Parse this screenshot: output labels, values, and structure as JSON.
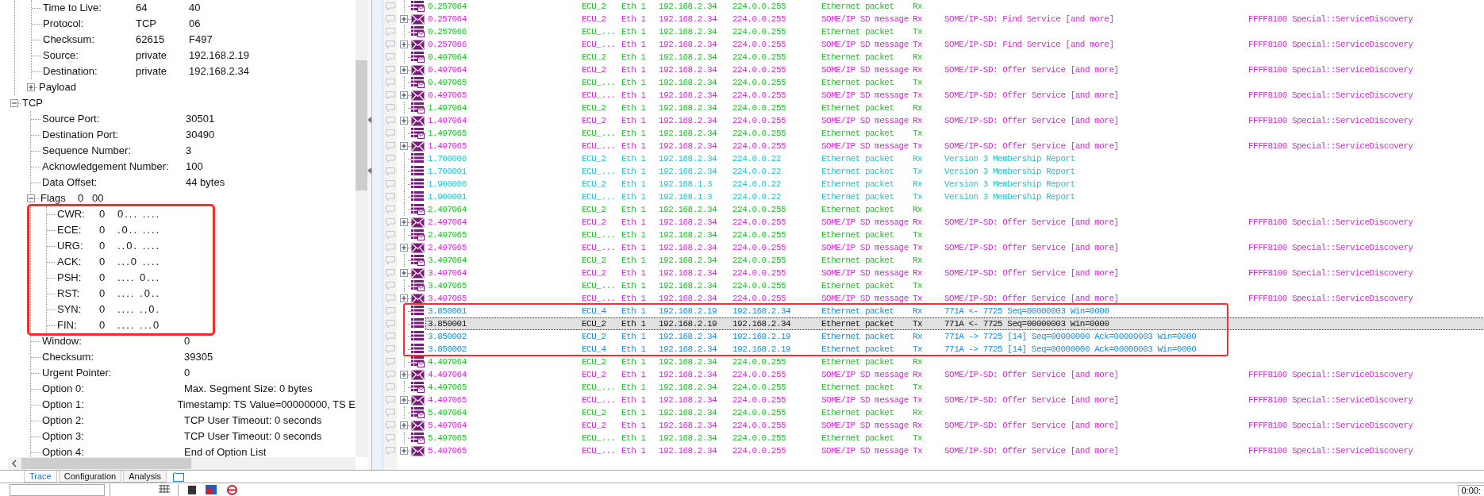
{
  "detail_tree": {
    "ip_fields": [
      {
        "label": "Time to Live:",
        "value": "64",
        "raw": "40"
      },
      {
        "label": "Protocol:",
        "value": "TCP",
        "raw": "06"
      },
      {
        "label": "Checksum:",
        "value": "62615",
        "raw": "F497"
      },
      {
        "label": "Source:",
        "value": "private",
        "raw": "192.168.2.19"
      },
      {
        "label": "Destination:",
        "value": "private",
        "raw": "192.168.2.34"
      }
    ],
    "payload": {
      "label": "Payload",
      "expanded": false
    },
    "tcp": {
      "label": "TCP",
      "expanded": true,
      "fields": [
        {
          "label": "Source Port:",
          "value": "30501"
        },
        {
          "label": "Destination Port:",
          "value": "30490"
        },
        {
          "label": "Sequence Number:",
          "value": "3"
        },
        {
          "label": "Acknowledgement Number:",
          "value": "100"
        },
        {
          "label": "Data Offset:",
          "value": "44 bytes"
        }
      ],
      "flags": {
        "label": "Flags",
        "value": "0",
        "raw": "00",
        "expanded": true,
        "outlined": true,
        "items": [
          {
            "label": "CWR:",
            "value": "0",
            "bits": "0... ...."
          },
          {
            "label": "ECE:",
            "value": "0",
            "bits": ".0.. ...."
          },
          {
            "label": "URG:",
            "value": "0",
            "bits": "..0. ...."
          },
          {
            "label": "ACK:",
            "value": "0",
            "bits": "...0 ...."
          },
          {
            "label": "PSH:",
            "value": "0",
            "bits": ".... 0..."
          },
          {
            "label": "RST:",
            "value": "0",
            "bits": ".... .0.."
          },
          {
            "label": "SYN:",
            "value": "0",
            "bits": ".... ..0."
          },
          {
            "label": "FIN:",
            "value": "0",
            "bits": ".... ...0"
          }
        ]
      },
      "fields_after": [
        {
          "label": "Window:",
          "value": "0"
        },
        {
          "label": "Checksum:",
          "value": "39305"
        },
        {
          "label": "Urgent Pointer:",
          "value": "0"
        },
        {
          "label": "Option 0:",
          "value": "Max. Segment Size: 0 bytes"
        },
        {
          "label": "Option 1:",
          "value": "Timestamp: TS Value=00000000, TS E"
        },
        {
          "label": "Option 2:",
          "value": "TCP User Timeout: 0 seconds"
        },
        {
          "label": "Option 3:",
          "value": "TCP User Timeout: 0 seconds"
        },
        {
          "label": "Option 4:",
          "value": "End of Option List"
        }
      ]
    }
  },
  "tabs": [
    {
      "label": "Trace",
      "selected": true
    },
    {
      "label": "Configuration",
      "selected": false
    },
    {
      "label": "Analysis",
      "selected": false
    }
  ],
  "trace": {
    "rows": [
      {
        "kind": "frame",
        "time": "0.257064",
        "ecu": "ECU_2",
        "channel": "Eth 1",
        "source": "192.168.2.34",
        "destination": "224.0.0.255",
        "type": "Ethernet packet",
        "dir": "Rx",
        "color": "#22c02a",
        "selected": false
      },
      {
        "kind": "someip",
        "time": "0.257064",
        "ecu": "ECU_2",
        "channel": "Eth 1",
        "source": "192.168.2.34",
        "destination": "224.0.0.255",
        "type": "SOME/IP SD message",
        "dir": "Rx",
        "info": "SOME/IP-SD: Find Service [and more]",
        "id": "FFFF8100 Special::ServiceDiscovery",
        "color": "#d42ad4",
        "expanded": false,
        "selected": false
      },
      {
        "kind": "frame",
        "time": "0.257066",
        "ecu": "ECU_...",
        "channel": "Eth 1",
        "source": "192.168.2.34",
        "destination": "224.0.0.255",
        "type": "Ethernet packet",
        "dir": "Tx",
        "color": "#22c02a",
        "selected": false
      },
      {
        "kind": "someip",
        "time": "0.257066",
        "ecu": "ECU_...",
        "channel": "Eth 1",
        "source": "192.168.2.34",
        "destination": "224.0.0.255",
        "type": "SOME/IP SD message",
        "dir": "Tx",
        "info": "SOME/IP-SD: Find Service [and more]",
        "id": "FFFF8100 Special::ServiceDiscovery",
        "color": "#d42ad4",
        "expanded": false,
        "selected": false
      },
      {
        "kind": "frame",
        "time": "0.497064",
        "ecu": "ECU_2",
        "channel": "Eth 1",
        "source": "192.168.2.34",
        "destination": "224.0.0.255",
        "type": "Ethernet packet",
        "dir": "Rx",
        "color": "#22c02a",
        "selected": false
      },
      {
        "kind": "someip",
        "time": "0.497064",
        "ecu": "ECU_2",
        "channel": "Eth 1",
        "source": "192.168.2.34",
        "destination": "224.0.0.255",
        "type": "SOME/IP SD message",
        "dir": "Rx",
        "info": "SOME/IP-SD: Offer Service [and more]",
        "id": "FFFF8100 Special::ServiceDiscovery",
        "color": "#d42ad4",
        "expanded": false,
        "selected": false
      },
      {
        "kind": "frame",
        "time": "0.497065",
        "ecu": "ECU_...",
        "channel": "Eth 1",
        "source": "192.168.2.34",
        "destination": "224.0.0.255",
        "type": "Ethernet packet",
        "dir": "Tx",
        "color": "#22c02a",
        "selected": false
      },
      {
        "kind": "someip",
        "time": "0.497065",
        "ecu": "ECU_...",
        "channel": "Eth 1",
        "source": "192.168.2.34",
        "destination": "224.0.0.255",
        "type": "SOME/IP SD message",
        "dir": "Tx",
        "info": "SOME/IP-SD: Offer Service [and more]",
        "id": "FFFF8100 Special::ServiceDiscovery",
        "color": "#d42ad4",
        "expanded": false,
        "selected": false
      },
      {
        "kind": "frame",
        "time": "1.497064",
        "ecu": "ECU_2",
        "channel": "Eth 1",
        "source": "192.168.2.34",
        "destination": "224.0.0.255",
        "type": "Ethernet packet",
        "dir": "Rx",
        "color": "#22c02a",
        "selected": false
      },
      {
        "kind": "someip",
        "time": "1.497064",
        "ecu": "ECU_2",
        "channel": "Eth 1",
        "source": "192.168.2.34",
        "destination": "224.0.0.255",
        "type": "SOME/IP SD message",
        "dir": "Rx",
        "info": "SOME/IP-SD: Offer Service [and more]",
        "id": "FFFF8100 Special::ServiceDiscovery",
        "color": "#d42ad4",
        "expanded": false,
        "selected": false
      },
      {
        "kind": "frame",
        "time": "1.497065",
        "ecu": "ECU_...",
        "channel": "Eth 1",
        "source": "192.168.2.34",
        "destination": "224.0.0.255",
        "type": "Ethernet packet",
        "dir": "Tx",
        "color": "#22c02a",
        "selected": false
      },
      {
        "kind": "someip",
        "time": "1.497065",
        "ecu": "ECU_...",
        "channel": "Eth 1",
        "source": "192.168.2.34",
        "destination": "224.0.0.255",
        "type": "SOME/IP SD message",
        "dir": "Tx",
        "info": "SOME/IP-SD: Offer Service [and more]",
        "id": "FFFF8100 Special::ServiceDiscovery",
        "color": "#d42ad4",
        "expanded": false,
        "selected": false
      },
      {
        "kind": "packet",
        "time": "1.700000",
        "ecu": "ECU_2",
        "channel": "Eth 1",
        "source": "192.168.2.34",
        "destination": "224.0.0.22",
        "type": "Ethernet packet",
        "dir": "Rx",
        "info": "Version 3 Membership Report",
        "color": "#22c4d2",
        "selected": false
      },
      {
        "kind": "packet",
        "time": "1.700001",
        "ecu": "ECU_...",
        "channel": "Eth 1",
        "source": "192.168.2.34",
        "destination": "224.0.0.22",
        "type": "Ethernet packet",
        "dir": "Tx",
        "info": "Version 3 Membership Report",
        "color": "#22c4d2",
        "selected": false
      },
      {
        "kind": "packet",
        "time": "1.900000",
        "ecu": "ECU_2",
        "channel": "Eth 1",
        "source": "192.168.1.3",
        "destination": "224.0.0.22",
        "type": "Ethernet packet",
        "dir": "Rx",
        "info": "Version 3 Membership Report",
        "color": "#22c4d2",
        "selected": false
      },
      {
        "kind": "packet",
        "time": "1.900001",
        "ecu": "ECU_...",
        "channel": "Eth 1",
        "source": "192.168.1.3",
        "destination": "224.0.0.22",
        "type": "Ethernet packet",
        "dir": "Tx",
        "info": "Version 3 Membership Report",
        "color": "#22c4d2",
        "selected": false
      },
      {
        "kind": "frame",
        "time": "2.497064",
        "ecu": "ECU_2",
        "channel": "Eth 1",
        "source": "192.168.2.34",
        "destination": "224.0.0.255",
        "type": "Ethernet packet",
        "dir": "Rx",
        "color": "#22c02a",
        "selected": false
      },
      {
        "kind": "someip",
        "time": "2.497064",
        "ecu": "ECU_2",
        "channel": "Eth 1",
        "source": "192.168.2.34",
        "destination": "224.0.0.255",
        "type": "SOME/IP SD message",
        "dir": "Rx",
        "info": "SOME/IP-SD: Offer Service [and more]",
        "id": "FFFF8100 Special::ServiceDiscovery",
        "color": "#d42ad4",
        "expanded": false,
        "selected": false
      },
      {
        "kind": "frame",
        "time": "2.497065",
        "ecu": "ECU_...",
        "channel": "Eth 1",
        "source": "192.168.2.34",
        "destination": "224.0.0.255",
        "type": "Ethernet packet",
        "dir": "Tx",
        "color": "#22c02a",
        "selected": false
      },
      {
        "kind": "someip",
        "time": "2.497065",
        "ecu": "ECU_...",
        "channel": "Eth 1",
        "source": "192.168.2.34",
        "destination": "224.0.0.255",
        "type": "SOME/IP SD message",
        "dir": "Tx",
        "info": "SOME/IP-SD: Offer Service [and more]",
        "id": "FFFF8100 Special::ServiceDiscovery",
        "color": "#d42ad4",
        "expanded": false,
        "selected": false
      },
      {
        "kind": "frame",
        "time": "3.497064",
        "ecu": "ECU_2",
        "channel": "Eth 1",
        "source": "192.168.2.34",
        "destination": "224.0.0.255",
        "type": "Ethernet packet",
        "dir": "Rx",
        "color": "#22c02a",
        "selected": false
      },
      {
        "kind": "someip",
        "time": "3.497064",
        "ecu": "ECU_2",
        "channel": "Eth 1",
        "source": "192.168.2.34",
        "destination": "224.0.0.255",
        "type": "SOME/IP SD message",
        "dir": "Rx",
        "info": "SOME/IP-SD: Offer Service [and more]",
        "id": "FFFF8100 Special::ServiceDiscovery",
        "color": "#d42ad4",
        "expanded": false,
        "selected": false
      },
      {
        "kind": "frame",
        "time": "3.497065",
        "ecu": "ECU_...",
        "channel": "Eth 1",
        "source": "192.168.2.34",
        "destination": "224.0.0.255",
        "type": "Ethernet packet",
        "dir": "Tx",
        "color": "#22c02a",
        "selected": false
      },
      {
        "kind": "someip",
        "time": "3.497065",
        "ecu": "ECU_...",
        "channel": "Eth 1",
        "source": "192.168.2.34",
        "destination": "224.0.0.255",
        "type": "SOME/IP SD message",
        "dir": "Tx",
        "info": "SOME/IP-SD: Offer Service [and more]",
        "id": "FFFF8100 Special::ServiceDiscovery",
        "color": "#d42ad4",
        "expanded": false,
        "selected": false
      },
      {
        "kind": "packet",
        "time": "3.850001",
        "ecu": "ECU_4",
        "channel": "Eth 1",
        "source": "192.168.2.19",
        "destination": "192.168.2.34",
        "type": "Ethernet packet",
        "dir": "Rx",
        "info": "771A <- 7725 Seq=00000003 Win=0000",
        "color": "#1a8ed6",
        "outlined": true,
        "selected": false
      },
      {
        "kind": "packet",
        "time": "3.850001",
        "ecu": "ECU_2",
        "channel": "Eth 1",
        "source": "192.168.2.19",
        "destination": "192.168.2.34",
        "type": "Ethernet packet",
        "dir": "Tx",
        "info": "771A <- 7725 Seq=00000003 Win=0000",
        "outlined": true,
        "selected": true
      },
      {
        "kind": "packet",
        "time": "3.850002",
        "ecu": "ECU_2",
        "channel": "Eth 1",
        "source": "192.168.2.34",
        "destination": "192.168.2.19",
        "type": "Ethernet packet",
        "dir": "Rx",
        "info": "771A -> 7725 [14] Seq=00000000 Ack=00000003 Win=0000",
        "color": "#1a8ed6",
        "outlined": true,
        "selected": false
      },
      {
        "kind": "packet",
        "time": "3.850002",
        "ecu": "ECU_4",
        "channel": "Eth 1",
        "source": "192.168.2.34",
        "destination": "192.168.2.19",
        "type": "Ethernet packet",
        "dir": "Tx",
        "info": "771A -> 7725 [14] Seq=00000000 Ack=00000003 Win=0000",
        "color": "#1a8ed6",
        "outlined": true,
        "selected": false
      },
      {
        "kind": "frame",
        "time": "4.497064",
        "ecu": "ECU_2",
        "channel": "Eth 1",
        "source": "192.168.2.34",
        "destination": "224.0.0.255",
        "type": "Ethernet packet",
        "dir": "Rx",
        "color": "#22c02a",
        "selected": false
      },
      {
        "kind": "someip",
        "time": "4.497064",
        "ecu": "ECU_2",
        "channel": "Eth 1",
        "source": "192.168.2.34",
        "destination": "224.0.0.255",
        "type": "SOME/IP SD message",
        "dir": "Rx",
        "info": "SOME/IP-SD: Offer Service [and more]",
        "id": "FFFF8100 Special::ServiceDiscovery",
        "color": "#d42ad4",
        "expanded": false,
        "selected": false
      },
      {
        "kind": "frame",
        "time": "4.497065",
        "ecu": "ECU_...",
        "channel": "Eth 1",
        "source": "192.168.2.34",
        "destination": "224.0.0.255",
        "type": "Ethernet packet",
        "dir": "Tx",
        "color": "#22c02a",
        "selected": false
      },
      {
        "kind": "someip",
        "time": "4.497065",
        "ecu": "ECU_...",
        "channel": "Eth 1",
        "source": "192.168.2.34",
        "destination": "224.0.0.255",
        "type": "SOME/IP SD message",
        "dir": "Tx",
        "info": "SOME/IP-SD: Offer Service [and more]",
        "id": "FFFF8100 Special::ServiceDiscovery",
        "color": "#d42ad4",
        "expanded": false,
        "selected": false
      },
      {
        "kind": "frame",
        "time": "5.497064",
        "ecu": "ECU_2",
        "channel": "Eth 1",
        "source": "192.168.2.34",
        "destination": "224.0.0.255",
        "type": "Ethernet packet",
        "dir": "Rx",
        "color": "#22c02a",
        "selected": false
      },
      {
        "kind": "someip",
        "time": "5.497064",
        "ecu": "ECU_2",
        "channel": "Eth 1",
        "source": "192.168.2.34",
        "destination": "224.0.0.255",
        "type": "SOME/IP SD message",
        "dir": "Rx",
        "info": "SOME/IP-SD: Offer Service [and more]",
        "id": "FFFF8100 Special::ServiceDiscovery",
        "color": "#d42ad4",
        "expanded": false,
        "selected": false
      },
      {
        "kind": "frame",
        "time": "5.497065",
        "ecu": "ECU_...",
        "channel": "Eth 1",
        "source": "192.168.2.34",
        "destination": "224.0.0.255",
        "type": "Ethernet packet",
        "dir": "Tx",
        "color": "#22c02a",
        "selected": false
      },
      {
        "kind": "someip",
        "time": "5.497065",
        "ecu": "ECU_...",
        "channel": "Eth 1",
        "source": "192.168.2.34",
        "destination": "224.0.0.255",
        "type": "SOME/IP SD message",
        "dir": "Tx",
        "info": "SOME/IP-SD: Offer Service [and more]",
        "id": "FFFF8100 Special::ServiceDiscovery",
        "color": "#d42ad4",
        "expanded": false,
        "selected": false
      }
    ]
  },
  "status_bar": {
    "time": "0:00:"
  }
}
